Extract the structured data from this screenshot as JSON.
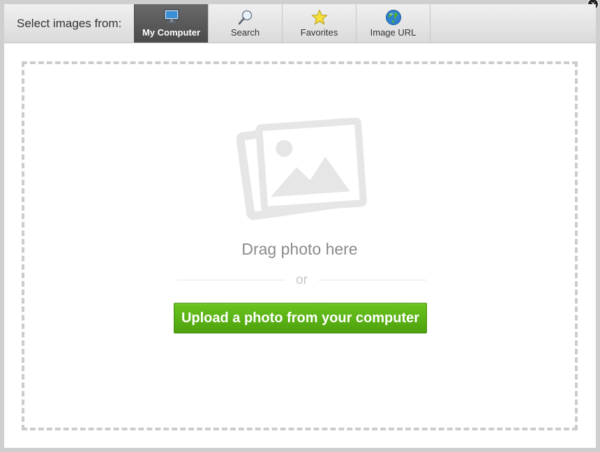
{
  "header": {
    "select_label": "Select images from:",
    "tabs": [
      {
        "label": "My Computer",
        "icon": "monitor-icon",
        "active": true
      },
      {
        "label": "Search",
        "icon": "magnifier-icon",
        "active": false
      },
      {
        "label": "Favorites",
        "icon": "star-icon",
        "active": false
      },
      {
        "label": "Image URL",
        "icon": "globe-icon",
        "active": false
      }
    ]
  },
  "close_label": "×",
  "dropzone": {
    "icon": "photo-placeholder-icon",
    "drag_text": "Drag photo here",
    "or_text": "or",
    "upload_label": "Upload a photo from your computer"
  },
  "colors": {
    "accent_green": "#5bb314",
    "active_tab": "#555555",
    "dashed_border": "#cccccc"
  }
}
